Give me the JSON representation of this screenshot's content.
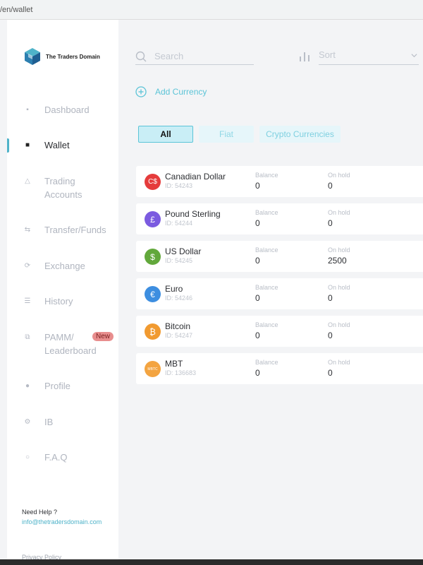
{
  "browser": {
    "url": "/en/wallet"
  },
  "brand": {
    "name": "The Traders Domain"
  },
  "sidebar": {
    "items": [
      {
        "label": "Dashboard",
        "icon": "grid-icon"
      },
      {
        "label": "Wallet",
        "icon": "wallet-icon",
        "active": true
      },
      {
        "label": "Trading Accounts",
        "icon": "triangle-icon"
      },
      {
        "label": "Transfer/Funds",
        "icon": "transfer-icon"
      },
      {
        "label": "Exchange",
        "icon": "exchange-icon"
      },
      {
        "label": "History",
        "icon": "list-icon"
      },
      {
        "label": "PAMM/ Leaderboard",
        "icon": "copy-icon",
        "badge": "New"
      },
      {
        "label": "Profile",
        "icon": "user-icon"
      },
      {
        "label": "IB",
        "icon": "ib-icon"
      },
      {
        "label": "F.A.Q",
        "icon": "chat-icon"
      }
    ],
    "help_title": "Need Help ?",
    "help_email": "info@thetradersdomain.com",
    "privacy": "Privacy Policy"
  },
  "toolbar": {
    "search_placeholder": "Search",
    "sort_label": "Sort",
    "add_currency": "Add Currency"
  },
  "filters": {
    "tabs": [
      {
        "label": "All",
        "selected": true
      },
      {
        "label": "Fiat"
      },
      {
        "label": "Crypto Currencies"
      }
    ]
  },
  "labels": {
    "balance": "Balance",
    "on_hold": "On hold"
  },
  "currencies": [
    {
      "name": "Canadian Dollar",
      "id": "ID: 54243",
      "balance": "0",
      "on_hold": "0",
      "symbol": "C$",
      "color": "#e53c3c"
    },
    {
      "name": "Pound Sterling",
      "id": "ID: 54244",
      "balance": "0",
      "on_hold": "0",
      "symbol": "£",
      "color": "#7b5be0"
    },
    {
      "name": "US Dollar",
      "id": "ID: 54245",
      "balance": "0",
      "on_hold": "2500",
      "symbol": "$",
      "color": "#62a83b"
    },
    {
      "name": "Euro",
      "id": "ID: 54246",
      "balance": "0",
      "on_hold": "0",
      "symbol": "€",
      "color": "#3d8ee0"
    },
    {
      "name": "Bitcoin",
      "id": "ID: 54247",
      "balance": "0",
      "on_hold": "0",
      "symbol": "₿",
      "color": "#f19a30"
    },
    {
      "name": "MBT",
      "id": "ID: 136683",
      "balance": "0",
      "on_hold": "0",
      "symbol": "MBTC",
      "color": "#f3a441"
    }
  ],
  "colors": {
    "accent": "#5bc4d7",
    "badge": "#e88e8e"
  }
}
